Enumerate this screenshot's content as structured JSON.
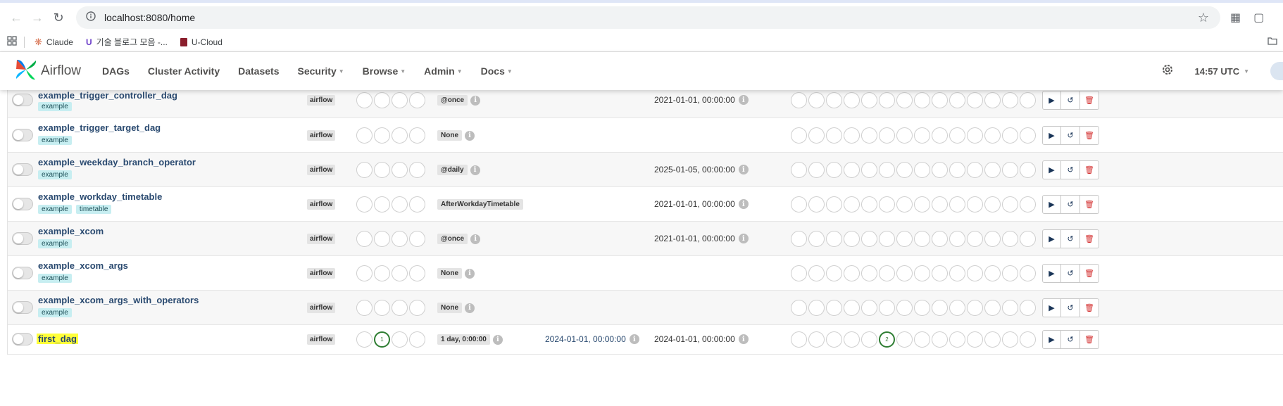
{
  "browser": {
    "url": "localhost:8080/home",
    "bookmarks": [
      "Claude",
      "기술 블로그 모음 -...",
      "U-Cloud"
    ]
  },
  "navbar": {
    "brand": "Airflow",
    "menu": [
      "DAGs",
      "Cluster Activity",
      "Datasets",
      "Security",
      "Browse",
      "Admin",
      "Docs"
    ],
    "time": "14:57 UTC"
  },
  "dags": [
    {
      "name": "example_trigger_controller_dag",
      "tags": [
        "example"
      ],
      "owner": "airflow",
      "schedule": "@once",
      "last_run": "",
      "next_run": "2021-01-01, 00:00:00",
      "recent_run_count": "",
      "dag_run_count": ""
    },
    {
      "name": "example_trigger_target_dag",
      "tags": [
        "example"
      ],
      "owner": "airflow",
      "schedule": "None",
      "last_run": "",
      "next_run": "",
      "recent_run_count": "",
      "dag_run_count": ""
    },
    {
      "name": "example_weekday_branch_operator",
      "tags": [
        "example"
      ],
      "owner": "airflow",
      "schedule": "@daily",
      "last_run": "",
      "next_run": "2025-01-05, 00:00:00",
      "recent_run_count": "",
      "dag_run_count": ""
    },
    {
      "name": "example_workday_timetable",
      "tags": [
        "example",
        "timetable"
      ],
      "owner": "airflow",
      "schedule": "AfterWorkdayTimetable",
      "last_run": "",
      "next_run": "2021-01-01, 00:00:00",
      "recent_run_count": "",
      "dag_run_count": ""
    },
    {
      "name": "example_xcom",
      "tags": [
        "example"
      ],
      "owner": "airflow",
      "schedule": "@once",
      "last_run": "",
      "next_run": "2021-01-01, 00:00:00",
      "recent_run_count": "",
      "dag_run_count": ""
    },
    {
      "name": "example_xcom_args",
      "tags": [
        "example"
      ],
      "owner": "airflow",
      "schedule": "None",
      "last_run": "",
      "next_run": "",
      "recent_run_count": "",
      "dag_run_count": ""
    },
    {
      "name": "example_xcom_args_with_operators",
      "tags": [
        "example"
      ],
      "owner": "airflow",
      "schedule": "None",
      "last_run": "",
      "next_run": "",
      "recent_run_count": "",
      "dag_run_count": ""
    },
    {
      "name": "first_dag",
      "tags": [],
      "owner": "airflow",
      "schedule": "1 day, 0:00:00",
      "last_run": "2024-01-01, 00:00:00",
      "next_run": "2024-01-01, 00:00:00",
      "recent_run_count": "1",
      "dag_run_count": "2"
    }
  ],
  "colors": {
    "success": "#2e7d32",
    "link": "#2a4a70",
    "tag_bg": "#c7eef1",
    "highlight": "#ffff3a",
    "delete": "#d32f2f"
  }
}
